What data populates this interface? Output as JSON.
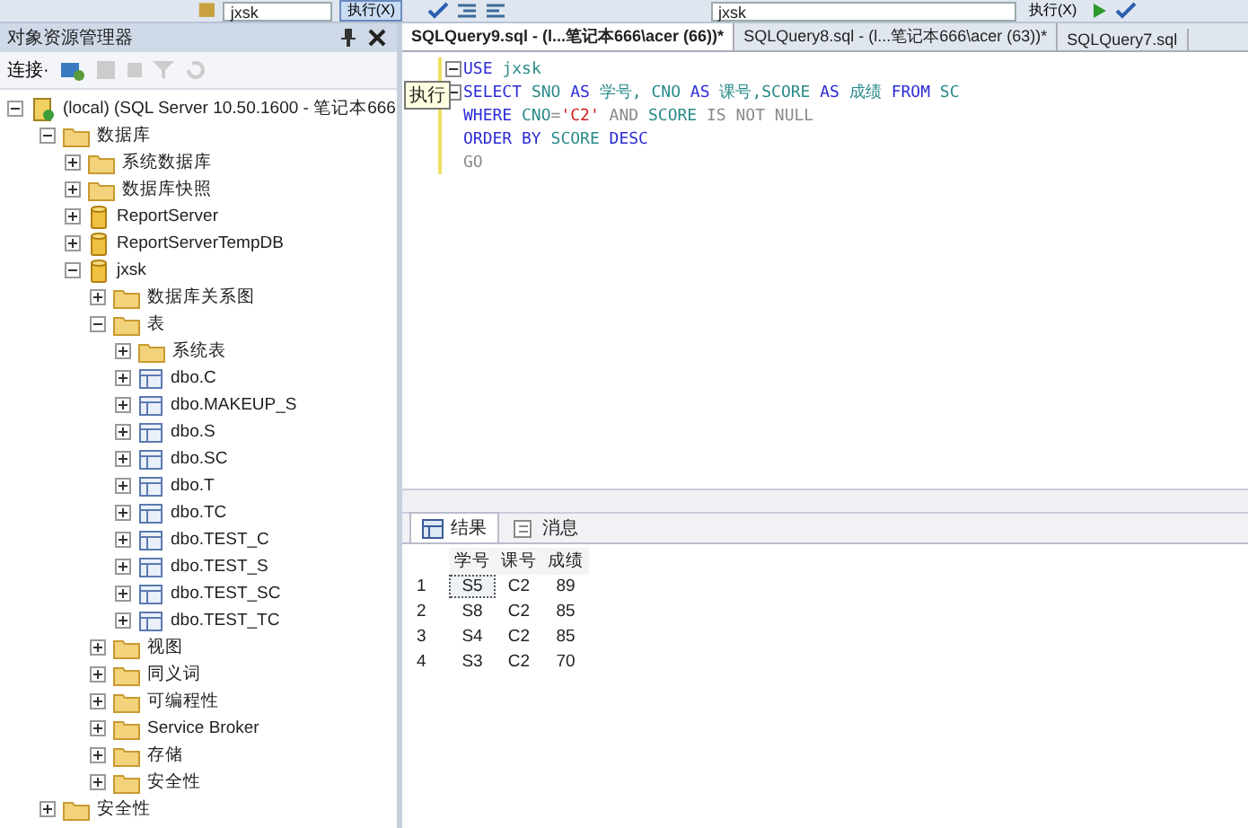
{
  "toolbar_left": {
    "database": "jxsk",
    "execute": "执行(X)"
  },
  "toolbar_right": {
    "database": "jxsk",
    "execute": "执行(X)"
  },
  "tooltip": "执行",
  "object_explorer": {
    "title": "对象资源管理器",
    "connect": "连接·",
    "tree": [
      {
        "label": "(local) (SQL Server 10.50.1600 - 笔记本666",
        "kind": "server",
        "expanded": true,
        "children": [
          {
            "label": "数据库",
            "kind": "folder",
            "expanded": true,
            "children": [
              {
                "label": "系统数据库",
                "kind": "folder",
                "expanded": false
              },
              {
                "label": "数据库快照",
                "kind": "folder",
                "expanded": false
              },
              {
                "label": "ReportServer",
                "kind": "database",
                "expanded": false
              },
              {
                "label": "ReportServerTempDB",
                "kind": "database",
                "expanded": false
              },
              {
                "label": "jxsk",
                "kind": "database",
                "expanded": true,
                "children": [
                  {
                    "label": "数据库关系图",
                    "kind": "folder",
                    "expanded": false
                  },
                  {
                    "label": "表",
                    "kind": "folder",
                    "expanded": true,
                    "children": [
                      {
                        "label": "系统表",
                        "kind": "folder",
                        "expanded": false
                      },
                      {
                        "label": "dbo.C",
                        "kind": "table",
                        "expanded": false
                      },
                      {
                        "label": "dbo.MAKEUP_S",
                        "kind": "table",
                        "expanded": false
                      },
                      {
                        "label": "dbo.S",
                        "kind": "table",
                        "expanded": false
                      },
                      {
                        "label": "dbo.SC",
                        "kind": "table",
                        "expanded": false
                      },
                      {
                        "label": "dbo.T",
                        "kind": "table",
                        "expanded": false
                      },
                      {
                        "label": "dbo.TC",
                        "kind": "table",
                        "expanded": false
                      },
                      {
                        "label": "dbo.TEST_C",
                        "kind": "table",
                        "expanded": false
                      },
                      {
                        "label": "dbo.TEST_S",
                        "kind": "table",
                        "expanded": false
                      },
                      {
                        "label": "dbo.TEST_SC",
                        "kind": "table",
                        "expanded": false
                      },
                      {
                        "label": "dbo.TEST_TC",
                        "kind": "table",
                        "expanded": false
                      }
                    ]
                  },
                  {
                    "label": "视图",
                    "kind": "folder",
                    "expanded": false
                  },
                  {
                    "label": "同义词",
                    "kind": "folder",
                    "expanded": false
                  },
                  {
                    "label": "可编程性",
                    "kind": "folder",
                    "expanded": false
                  },
                  {
                    "label": "Service Broker",
                    "kind": "folder",
                    "expanded": false
                  },
                  {
                    "label": "存储",
                    "kind": "folder",
                    "expanded": false
                  },
                  {
                    "label": "安全性",
                    "kind": "folder",
                    "expanded": false
                  }
                ]
              }
            ]
          },
          {
            "label": "安全性",
            "kind": "folder",
            "expanded": false
          }
        ]
      }
    ]
  },
  "tabs": [
    {
      "label": "SQLQuery9.sql - (l...笔记本666\\acer (66))*",
      "selected": true
    },
    {
      "label": "SQLQuery8.sql - (l...笔记本666\\acer (63))*",
      "selected": false
    },
    {
      "label": "SQLQuery7.sql",
      "selected": false
    }
  ],
  "editor": {
    "lines": [
      {
        "fold": true,
        "tokens": [
          {
            "kind": "kw",
            "text": "USE "
          },
          {
            "kind": "id",
            "text": "jxsk"
          }
        ]
      },
      {
        "fold": true,
        "tokens": [
          {
            "kind": "kw",
            "text": "SELECT "
          },
          {
            "kind": "id",
            "text": "SNO "
          },
          {
            "kind": "kw",
            "text": "AS "
          },
          {
            "kind": "id",
            "text": "学号, "
          },
          {
            "kind": "id",
            "text": "CNO "
          },
          {
            "kind": "kw",
            "text": "AS "
          },
          {
            "kind": "id",
            "text": "课号,"
          },
          {
            "kind": "id",
            "text": "SCORE "
          },
          {
            "kind": "kw",
            "text": "AS "
          },
          {
            "kind": "id",
            "text": "成绩 "
          },
          {
            "kind": "kw",
            "text": "FROM "
          },
          {
            "kind": "id",
            "text": "SC"
          }
        ]
      },
      {
        "fold": false,
        "tokens": [
          {
            "kind": "kw",
            "text": "WHERE "
          },
          {
            "kind": "id",
            "text": "CNO"
          },
          {
            "kind": "op",
            "text": "="
          },
          {
            "kind": "str",
            "text": "'C2'"
          },
          {
            "kind": "op",
            "text": " AND "
          },
          {
            "kind": "id",
            "text": "SCORE "
          },
          {
            "kind": "op",
            "text": "IS NOT NULL"
          }
        ]
      },
      {
        "fold": false,
        "tokens": [
          {
            "kind": "kw",
            "text": "ORDER BY "
          },
          {
            "kind": "id",
            "text": "SCORE "
          },
          {
            "kind": "kw",
            "text": "DESC"
          }
        ]
      },
      {
        "fold": false,
        "tokens": [
          {
            "kind": "op",
            "text": "GO"
          }
        ]
      }
    ]
  },
  "result_tabs": [
    {
      "label": "结果",
      "kind": "grid",
      "selected": true
    },
    {
      "label": "消息",
      "kind": "messages",
      "selected": false
    }
  ],
  "results": {
    "columns": [
      "学号",
      "课号",
      "成绩"
    ],
    "rows": [
      {
        "number": "1",
        "cells": [
          "S5",
          "C2",
          "89"
        ],
        "selected": true
      },
      {
        "number": "2",
        "cells": [
          "S8",
          "C2",
          "85"
        ],
        "selected": false
      },
      {
        "number": "3",
        "cells": [
          "S4",
          "C2",
          "85"
        ],
        "selected": false
      },
      {
        "number": "4",
        "cells": [
          "S3",
          "C2",
          "70"
        ],
        "selected": false
      }
    ]
  }
}
